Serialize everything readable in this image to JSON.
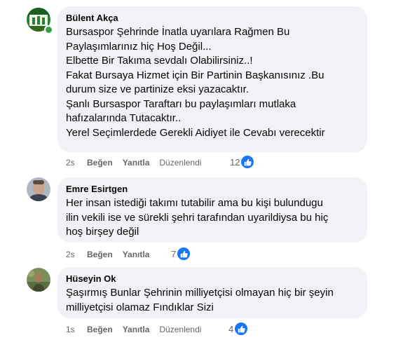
{
  "comments": [
    {
      "author": "Bülent Akça",
      "lines": [
        "Bursaspor Şehrinde İnatla uyarılara Rağmen Bu",
        "Paylaşımlarınız hiç Hoş Değil...",
        "Elbette Bir Takıma sevdalı Olabilirsiniz..!",
        "Fakat Bursaya Hizmet için Bir Partinin Başkanısınız .Bu",
        "durum size ve partinize eksi yazacaktır.",
        "Şanlı Bursaspor Taraftarı bu paylaşımları mutlaka",
        "hafızalarında Tutacaktır..",
        "Yerel Seçimlerdede Gerekli Aidiyet ile Cevabı verecektir"
      ],
      "time": "2s",
      "like_label": "Beğen",
      "reply_label": "Yanıtla",
      "edited_label": "Düzenlendi",
      "reaction_count": "12",
      "online": true
    },
    {
      "author": "Emre Esirtgen",
      "lines": [
        "Her insan istediği takımı tutabilir ama bu kişi bulundugu",
        "ilin vekili ise ve sürekli şehri tarafından uyarildiysa bu hiç",
        "hoş birşey değil"
      ],
      "time": "2s",
      "like_label": "Beğen",
      "reply_label": "Yanıtla",
      "reaction_count": "7",
      "online": false
    },
    {
      "author": "Hüseyin Ok",
      "lines": [
        "Şaşırmış Bunlar Şehrinin milliyetçisi olmayan hiç bir şeyin",
        "milliyetçisi olamaz Fındıklar Sizi"
      ],
      "time": "1s",
      "like_label": "Beğen",
      "reply_label": "Yanıtla",
      "edited_label": "Düzenlendi",
      "reaction_count": "4",
      "online": false
    }
  ],
  "colors": {
    "bubble_bg": "#f0f2f5",
    "like_blue": "#1877f2",
    "meta_gray": "#65676b",
    "online_green": "#31a24c"
  },
  "icons": {
    "reaction": "like-thumb-icon"
  }
}
